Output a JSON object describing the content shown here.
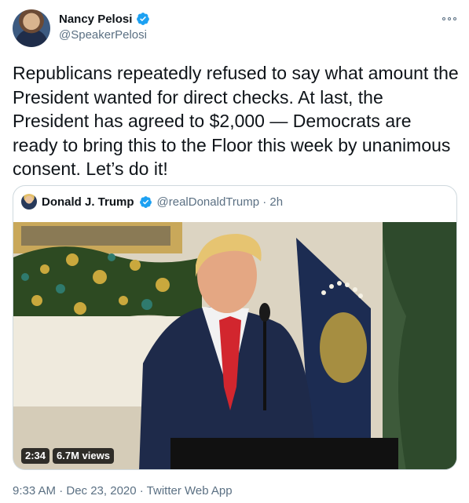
{
  "author": {
    "name": "Nancy Pelosi",
    "handle": "@SpeakerPelosi"
  },
  "tweet": {
    "text": "Republicans repeatedly refused to say what amount the President wanted for direct checks. At last, the President has agreed to $2,000 — Democrats are ready to bring this to the Floor this week by unanimous consent. Let’s do it!",
    "timestamp": "9:33 AM · Dec 23, 2020 · Twitter Web App"
  },
  "quoted": {
    "name": "Donald J. Trump",
    "handle_time": "@realDonaldTrump · 2h",
    "video": {
      "duration": "2:34",
      "views": "6.7M views"
    }
  },
  "icons": {
    "verified": "verified-badge-icon",
    "more": "more-options-icon"
  },
  "colors": {
    "verified_blue": "#1da1f2",
    "secondary_text": "#5b7083",
    "border": "#cfd9de"
  }
}
